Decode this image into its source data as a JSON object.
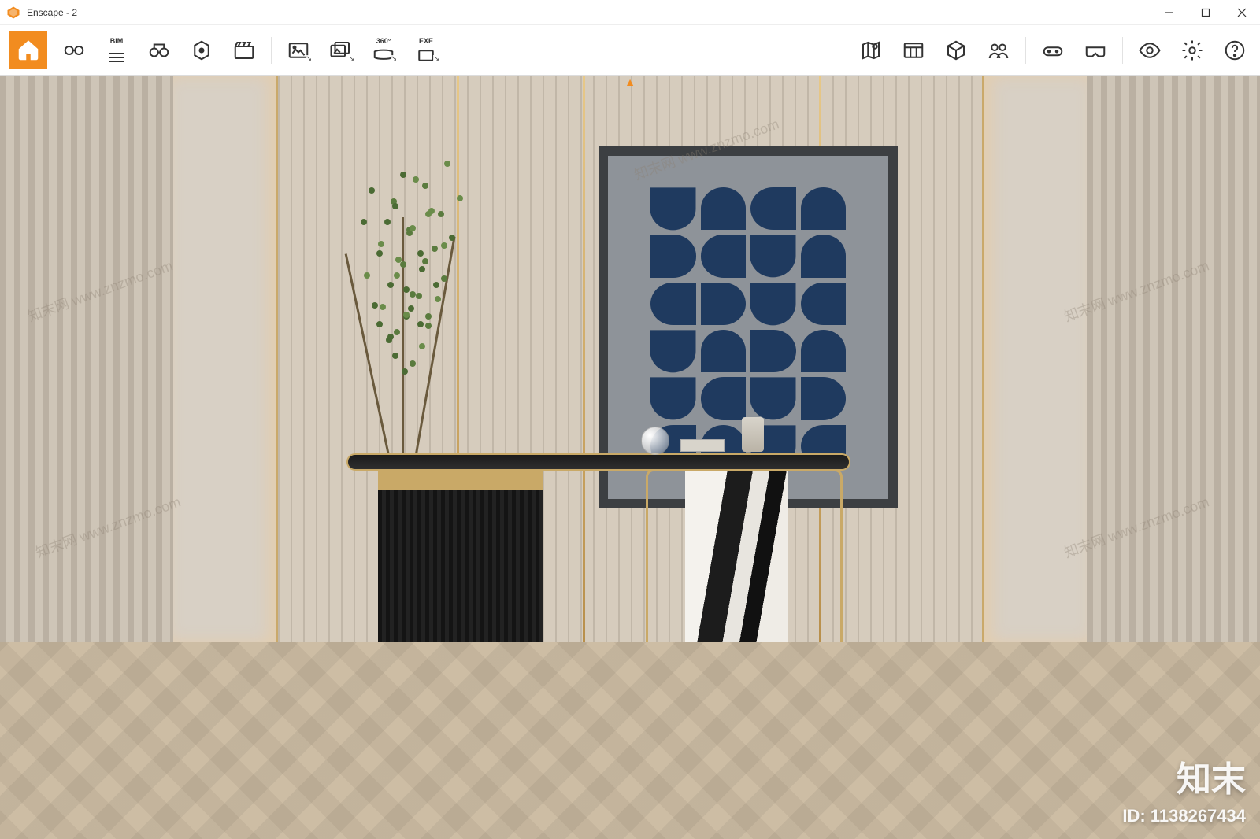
{
  "titlebar": {
    "title": "Enscape - 2"
  },
  "toolbar": {
    "bim_label": "BIM",
    "pano_label": "360°",
    "exe_label": "EXE"
  },
  "watermark": {
    "text": "知末网 www.znzmo.com",
    "brand": "知末",
    "id_prefix": "ID: ",
    "id_value": "1138267434"
  }
}
